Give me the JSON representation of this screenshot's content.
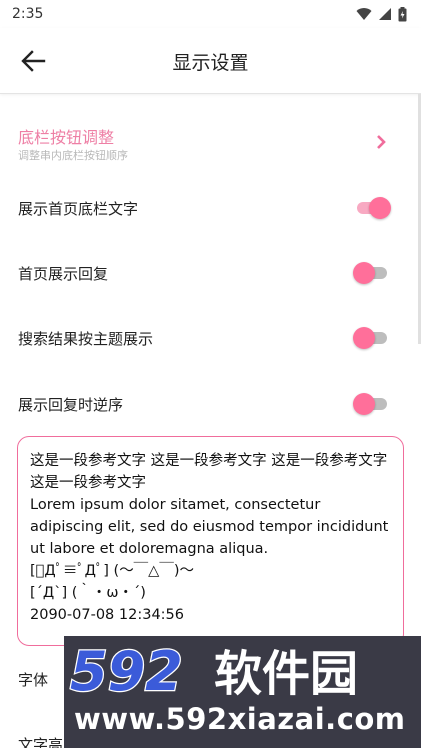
{
  "status_bar": {
    "time": "2:35"
  },
  "app_bar": {
    "title": "显示设置"
  },
  "bottom_bar_setting": {
    "title": "底栏按钮调整",
    "subtitle": "调整串内底栏按钮顺序"
  },
  "settings": [
    {
      "label": "展示首页底栏文字",
      "on": true
    },
    {
      "label": "首页展示回复",
      "on": false
    },
    {
      "label": "搜索结果按主题展示",
      "on": false
    },
    {
      "label": "展示回复时逆序",
      "on": false
    }
  ],
  "preview": {
    "lines": [
      "这是一段参考文字 这是一段参考文字 这是一段参考文字 这是一段参考文字",
      "Lorem ipsum dolor sitamet, consectetur adipiscing elit, sed do eiusmod tempor incididunt ut labore et doloremagna aliqua.",
      "[ﾟДﾟ≡ﾟДﾟ] (〜￣△￣)〜",
      "[´Д`] (｀・ω・´)",
      "2090-07-08 12:34:56"
    ]
  },
  "more_settings": {
    "font_label": "字体",
    "text_label": "文字高"
  },
  "watermark": {
    "logo_text": "592软件园",
    "url": "www.592xiazai.com"
  },
  "colors": {
    "accent": "#ff6f9a",
    "accent_light": "#f8a9c2",
    "pink_text": "#ee7fa5",
    "watermark_bg": "#3a3a46",
    "logo_blue": "#3b5bd9"
  }
}
